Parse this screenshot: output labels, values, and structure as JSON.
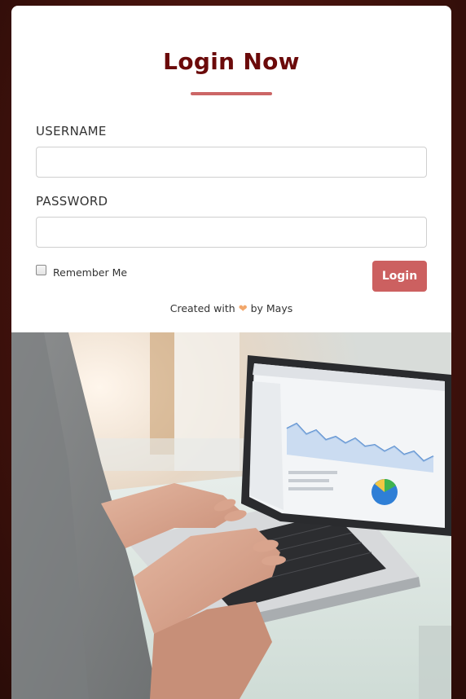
{
  "form": {
    "title": "Login Now",
    "username_label": "USERNAME",
    "username_value": "",
    "password_label": "PASSWORD",
    "password_value": "",
    "remember_label": "Remember Me",
    "remember_checked": false,
    "login_button": "Login"
  },
  "footer": {
    "prefix": "Created with",
    "heart_icon": "heart-icon",
    "suffix": "by Mays"
  },
  "colors": {
    "accent": "#cc6060",
    "title": "#6b0a0a",
    "background": "#4a140e",
    "heart": "#f2a76b"
  },
  "photo": {
    "subject": "laptop-analytics-photo",
    "chart_icon": "pie-chart-icon"
  }
}
